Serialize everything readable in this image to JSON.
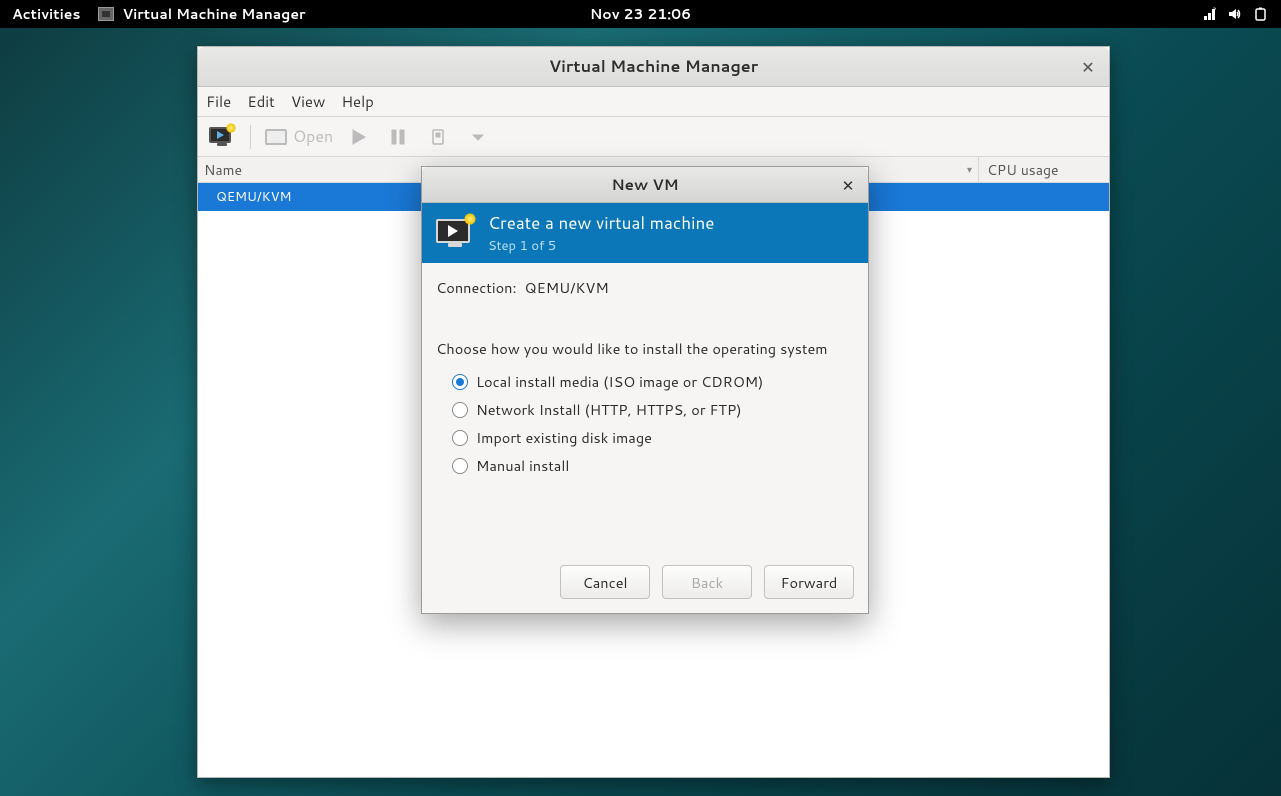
{
  "topbar": {
    "activities": "Activities",
    "app_title": "Virtual Machine Manager",
    "clock": "Nov 23  21:06"
  },
  "window": {
    "title": "Virtual Machine Manager",
    "menu": {
      "file": "File",
      "edit": "Edit",
      "view": "View",
      "help": "Help"
    },
    "toolbar": {
      "open_label": "Open"
    },
    "columns": {
      "name": "Name",
      "cpu": "CPU usage"
    },
    "rows": [
      {
        "label": "QEMU/KVM"
      }
    ]
  },
  "dialog": {
    "title": "New VM",
    "header_title": "Create a new virtual machine",
    "header_step": "Step 1 of 5",
    "connection_label": "Connection:",
    "connection_value": "QEMU/KVM",
    "install_prompt": "Choose how you would like to install the operating system",
    "options": {
      "local": "Local install media (ISO image or CDROM)",
      "network": "Network Install (HTTP, HTTPS, or FTP)",
      "import": "Import existing disk image",
      "manual": "Manual install"
    },
    "buttons": {
      "cancel": "Cancel",
      "back": "Back",
      "forward": "Forward"
    }
  }
}
